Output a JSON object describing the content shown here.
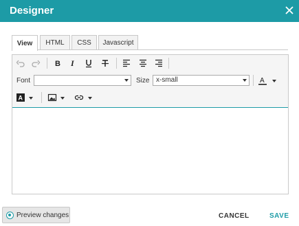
{
  "dialog": {
    "title": "Designer",
    "close_icon": "close-icon"
  },
  "tabs": [
    {
      "label": "View",
      "active": true
    },
    {
      "label": "HTML",
      "active": false
    },
    {
      "label": "CSS",
      "active": false
    },
    {
      "label": "Javascript",
      "active": false
    }
  ],
  "toolbar": {
    "font_label": "Font",
    "font_value": "",
    "size_label": "Size",
    "size_value": "x-small",
    "icons": [
      "undo-icon",
      "redo-icon",
      "bold-icon",
      "italic-icon",
      "underline-icon",
      "strikethrough-icon",
      "align-left-icon",
      "align-center-icon",
      "align-right-icon",
      "font-color-icon",
      "background-color-icon",
      "image-icon",
      "link-icon"
    ]
  },
  "footer": {
    "preview_label": "Preview changes",
    "cancel_label": "CANCEL",
    "save_label": "SAVE"
  },
  "colors": {
    "accent": "#1d9ba6",
    "toolbar_bg": "#f5f5f5"
  }
}
